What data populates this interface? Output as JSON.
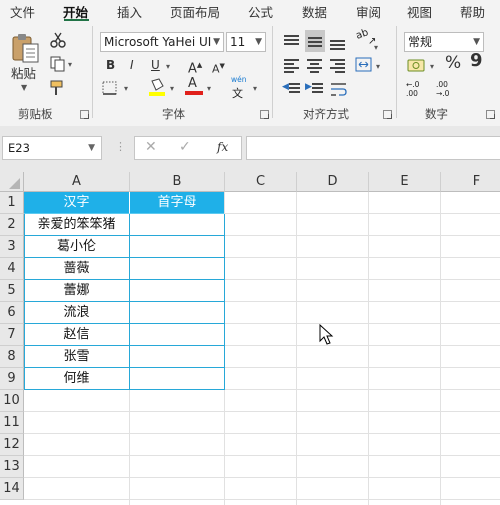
{
  "menu": {
    "tabs": [
      {
        "label": "文件"
      },
      {
        "label": "开始",
        "active": true
      },
      {
        "label": "插入"
      },
      {
        "label": "页面布局"
      },
      {
        "label": "公式"
      },
      {
        "label": "数据"
      },
      {
        "label": "审阅"
      },
      {
        "label": "视图"
      },
      {
        "label": "帮助"
      }
    ]
  },
  "ribbon": {
    "clipboard": {
      "paste_label": "粘贴",
      "group_label": "剪贴板"
    },
    "font": {
      "font_name": "Microsoft YaHei UI",
      "font_size": "11",
      "bold": "B",
      "italic": "I",
      "underline": "U",
      "font_color_glyph": "A",
      "phonetic_top": "wén",
      "phonetic_bottom": "文",
      "group_label": "字体",
      "highlight_color": "#ffff00",
      "font_color": "#e0201b"
    },
    "alignment": {
      "group_label": "对齐方式"
    },
    "number": {
      "format": "常规",
      "percent": "%",
      "comma": "9",
      "group_label": "数字"
    }
  },
  "formula_bar": {
    "name_box": "E23",
    "fx": "fx",
    "formula": ""
  },
  "sheet": {
    "columns": [
      "A",
      "B",
      "C",
      "D",
      "E",
      "F"
    ],
    "rows": [
      "1",
      "2",
      "3",
      "4",
      "5",
      "6",
      "7",
      "8",
      "9",
      "10",
      "11",
      "12",
      "13",
      "14"
    ],
    "header": {
      "a": "汉字",
      "b": "首字母"
    },
    "data": [
      {
        "a": "亲爱的笨笨猪",
        "b": ""
      },
      {
        "a": "葛小伦",
        "b": ""
      },
      {
        "a": "蔷薇",
        "b": ""
      },
      {
        "a": "蕾娜",
        "b": ""
      },
      {
        "a": "流浪",
        "b": ""
      },
      {
        "a": "赵信",
        "b": ""
      },
      {
        "a": "张雪",
        "b": ""
      },
      {
        "a": "何维",
        "b": ""
      }
    ],
    "header_fill": "#1fb0e8",
    "border_color": "#27a8d8"
  }
}
